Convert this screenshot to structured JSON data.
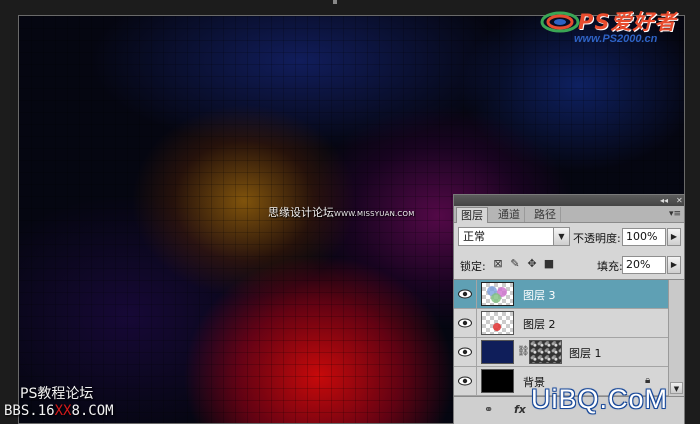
{
  "logo": {
    "title": "PS爱好者",
    "url": "www.PS2000.cn"
  },
  "canvas": {
    "watermark_cn": "思缘设计论坛",
    "watermark_url": "WWW.MISSYUAN.COM"
  },
  "bottom_left": {
    "title": "PS教程论坛",
    "url_prefix": "BBS.16",
    "url_middle": "XX",
    "url_suffix": "8.COM"
  },
  "brand": "UiBQ.CoM",
  "panel": {
    "collapse_glyph": "◂◂",
    "close_glyph": "✕",
    "menu_glyph": "▾≡",
    "tabs": [
      {
        "label": "图层",
        "active": true
      },
      {
        "label": "通道",
        "active": false
      },
      {
        "label": "路径",
        "active": false
      }
    ],
    "blend_mode": "正常",
    "opacity_label": "不透明度:",
    "opacity_value": "100%",
    "lock_label": "锁定:",
    "fill_label": "填充:",
    "fill_value": "20%",
    "layers": [
      {
        "name": "图层 3",
        "selected": true,
        "thumb": "checker-colors"
      },
      {
        "name": "图层 2",
        "selected": false,
        "thumb": "checker-red"
      },
      {
        "name": "图层 1",
        "selected": false,
        "thumb": "navy-with-mask"
      },
      {
        "name": "背景",
        "selected": false,
        "thumb": "black",
        "locked": true
      }
    ],
    "footer_icons": [
      "link-icon",
      "fx-icon"
    ]
  },
  "colors": {
    "selected_layer": "#5fa0b4",
    "panel_bg": "#d6d6d6",
    "logo_red": "#e84c2e",
    "logo_blue": "#2e62c4"
  }
}
